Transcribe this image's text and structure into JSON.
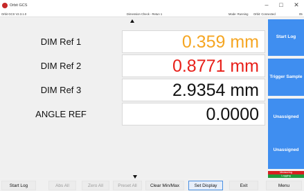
{
  "window": {
    "title": "Orbit GCS",
    "controls": {
      "minimize": "–",
      "maximize": "□",
      "close": "✕"
    }
  },
  "infobar": {
    "version": "Orbit GCS V2.3.1.0",
    "page_title": "Dimension Check - Retun 1",
    "status_mode": "Mode: Running",
    "status_orbit": "Orbit: Connected",
    "status_extra": "05"
  },
  "rows": [
    {
      "label": "DIM Ref 1",
      "value": "0.359 mm",
      "color": "#f5a623"
    },
    {
      "label": "DIM Ref 2",
      "value": "0.8771 mm",
      "color": "#e8201a"
    },
    {
      "label": "DIM Ref 3",
      "value": "2.9354 mm",
      "color": "#111111"
    },
    {
      "label": "ANGLE REF",
      "value": "0.0000",
      "color": "#111111"
    }
  ],
  "side_buttons": [
    {
      "label": "Start Log"
    },
    {
      "label": "Trigger Sample"
    },
    {
      "label": "Unassigned"
    },
    {
      "label": "Unassigned"
    }
  ],
  "status": {
    "measuring": "Measuring",
    "logging": "Logging"
  },
  "bottom": {
    "start_log": "Start Log",
    "abs_all": "Abs All",
    "zero_all": "Zero All",
    "preset_all": "Preset All",
    "clear_minmax": "Clear Min/Max",
    "set_display": "Set Display",
    "exit": "Exit",
    "menu": "Menu"
  },
  "colors": {
    "accent": "#3f8ef0",
    "measuring": "#d62020",
    "logging": "#1e9b3c"
  }
}
